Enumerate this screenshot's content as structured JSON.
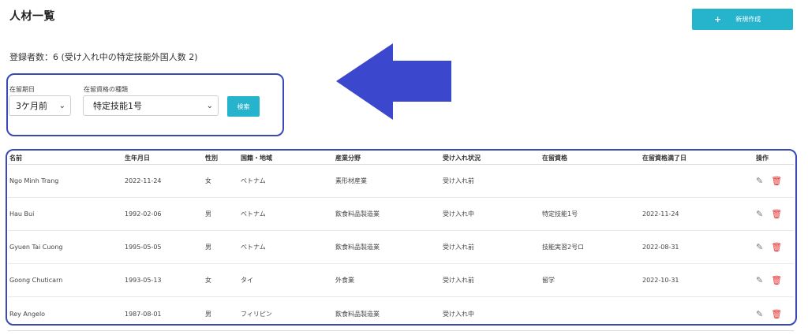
{
  "page": {
    "title": "人材一覧"
  },
  "toolbar": {
    "new_label": "新規作成",
    "new_icon": "plus-icon"
  },
  "summary": {
    "text": "登録者数：6 (受け入れ中の特定技能外国人数 2)"
  },
  "filters": {
    "date_label": "在留期日",
    "date_value": "3ケ月前",
    "status_label": "在留資格の種類",
    "status_value": "特定技能1号",
    "search_label": "検索"
  },
  "table": {
    "headers": [
      "名前",
      "生年月日",
      "性別",
      "国籍・地域",
      "産業分野",
      "受け入れ状況",
      "在留資格",
      "在留資格満了日",
      "操作"
    ],
    "rows": [
      [
        "Ngo Minh Trang",
        "2022-11-24",
        "女",
        "ベトナム",
        "素形材産業",
        "受け入れ前",
        "",
        ""
      ],
      [
        "Hau Bui",
        "1992-02-06",
        "男",
        "ベトナム",
        "飲食料品製造業",
        "受け入れ中",
        "特定技能1号",
        "2022-11-24"
      ],
      [
        "Gyuen Tai Cuong",
        "1995-05-05",
        "男",
        "ベトナム",
        "飲食料品製造業",
        "受け入れ前",
        "技能実習2号ロ",
        "2022-08-31"
      ],
      [
        "Goong Chuticarn",
        "1993-05-13",
        "女",
        "タイ",
        "外食業",
        "受け入れ前",
        "留学",
        "2022-10-31"
      ],
      [
        "Rey Angelo",
        "1987-08-01",
        "男",
        "フィリピン",
        "飲食料品製造業",
        "受け入れ中",
        "",
        ""
      ]
    ]
  },
  "colors": {
    "accent": "#26b3cc",
    "highlight": "#3949b8",
    "delete": "#e03131"
  }
}
